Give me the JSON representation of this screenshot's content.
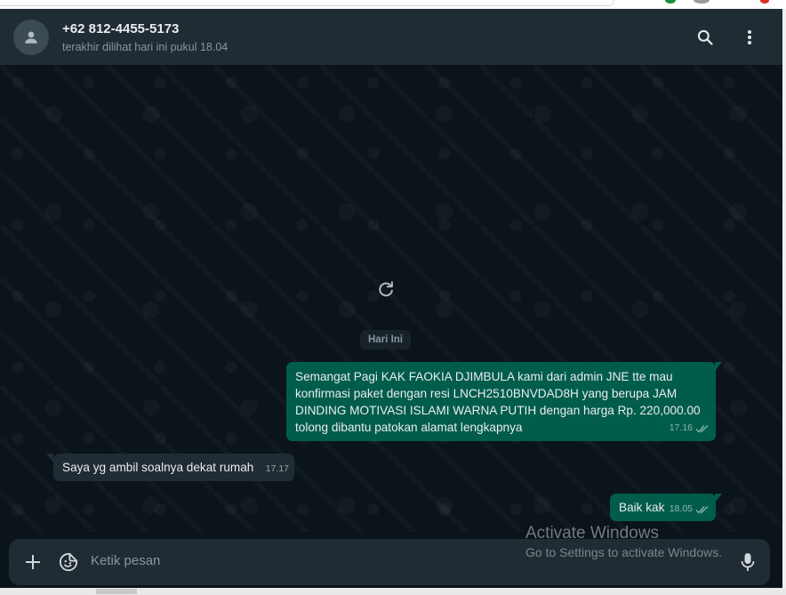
{
  "header": {
    "contact_name": "+62 812-4455-5173",
    "contact_status": "terakhir dilihat hari ini pukul 18.04",
    "search_icon": "search-icon",
    "menu_icon": "more-vertical-icon"
  },
  "chat": {
    "date_label": "Hari Ini",
    "messages": [
      {
        "direction": "outgoing",
        "lines": [
          "Semangat Pagi KAK FAOKIA DJIMBULA kami dari admin JNE tte mau",
          "konfirmasi paket dengan resi LNCH2510BNVDAD8H yang berupa JAM",
          "DINDING MOTIVASI ISLAMI WARNA PUTIH dengan harga Rp. 220,000.00",
          "tolong dibantu patokan alamat lengkapnya"
        ],
        "time": "17.16",
        "status": "double-check-icon"
      },
      {
        "direction": "incoming",
        "lines": [
          "Saya yg ambil soalnya dekat rumah"
        ],
        "time": "17.17"
      },
      {
        "direction": "outgoing",
        "lines": [
          "Baik kak"
        ],
        "time": "18.05",
        "status": "double-check-icon"
      }
    ]
  },
  "composer": {
    "placeholder": "Ketik pesan",
    "attach_icon": "plus-icon",
    "sticker_icon": "sticker-icon",
    "mic_icon": "microphone-icon"
  },
  "watermark": {
    "title": "Activate Windows",
    "subtitle": "Go to Settings to activate Windows."
  },
  "colors": {
    "header_bg": "#202c33",
    "chat_bg": "#0b141a",
    "outgoing_bubble": "#005c4b",
    "incoming_bubble": "#202c33",
    "tick_color": "#8ab3a8"
  }
}
